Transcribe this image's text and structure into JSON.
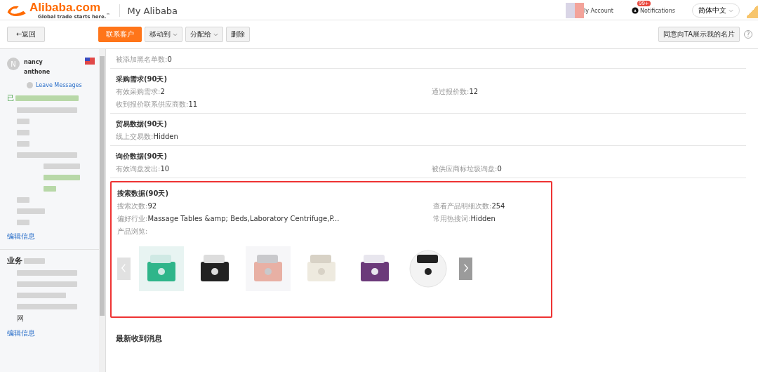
{
  "header": {
    "logo_name": "Alibaba.com",
    "logo_tagline": "Global trade starts here.",
    "logo_tm": "™",
    "title": "My Alibaba",
    "account": "ly Account",
    "notifications": "Notifications",
    "badge": "99+",
    "language": "简体中文"
  },
  "toolbar": {
    "back": "←返回",
    "buttons": [
      {
        "label": "联系客户",
        "kind": "primary"
      },
      {
        "label": "移动到",
        "kind": "dropdown"
      },
      {
        "label": "分配给",
        "kind": "dropdown"
      },
      {
        "label": "删除",
        "kind": "plain"
      }
    ],
    "share": "同意向TA展示我的名片",
    "help": "?"
  },
  "sidebar": {
    "avatar": "N",
    "name_first": "nancy",
    "name_last": "anthone",
    "leave_messages": "Leave Messages",
    "status_char": "已",
    "edit_links": [
      "编辑信息",
      "编辑信息"
    ],
    "section_title": "业务",
    "last_char": "网"
  },
  "sections": [
    {
      "rows": [
        [
          {
            "label": "被添加黑名单数:",
            "value": "0"
          }
        ]
      ]
    },
    {
      "title": "采购需求(90天)",
      "rows": [
        [
          {
            "label": "有效采购需求:",
            "value": "2"
          },
          {
            "label": "通过报价数:",
            "value": "12"
          }
        ],
        [
          {
            "label": "收到报价联系供应商数:",
            "value": "11"
          }
        ]
      ]
    },
    {
      "title": "贸易数据(90天)",
      "rows": [
        [
          {
            "label": "线上交易数:",
            "value": "Hidden"
          }
        ]
      ]
    },
    {
      "title": "询价数据(90天)",
      "rows": [
        [
          {
            "label": "有效询盘发出:",
            "value": "10"
          },
          {
            "label": "被供应商标垃圾询盘:",
            "value": "0"
          }
        ]
      ]
    },
    {
      "title": "搜索数据(90天)",
      "highlighted": true,
      "rows": [
        [
          {
            "label": "搜索次数:",
            "value": "92"
          },
          {
            "label": "查看产品明细次数:",
            "value": "254"
          }
        ],
        [
          {
            "label": "偏好行业:",
            "value": "Massage Tables &amp; Beds,Laboratory Centrifuge,P..."
          },
          {
            "label": "常用热搜词:",
            "value": "Hidden"
          }
        ],
        [
          {
            "label": "产品浏览:"
          }
        ]
      ],
      "products": [
        {
          "kind": "box"
        },
        {
          "kind": "bags"
        },
        {
          "kind": "chair"
        },
        {
          "kind": "toilet"
        },
        {
          "kind": "centrifuge"
        },
        {
          "kind": "disc"
        }
      ],
      "prev_enabled": false,
      "next_enabled": true
    }
  ],
  "messages_title": "最新收到消息"
}
